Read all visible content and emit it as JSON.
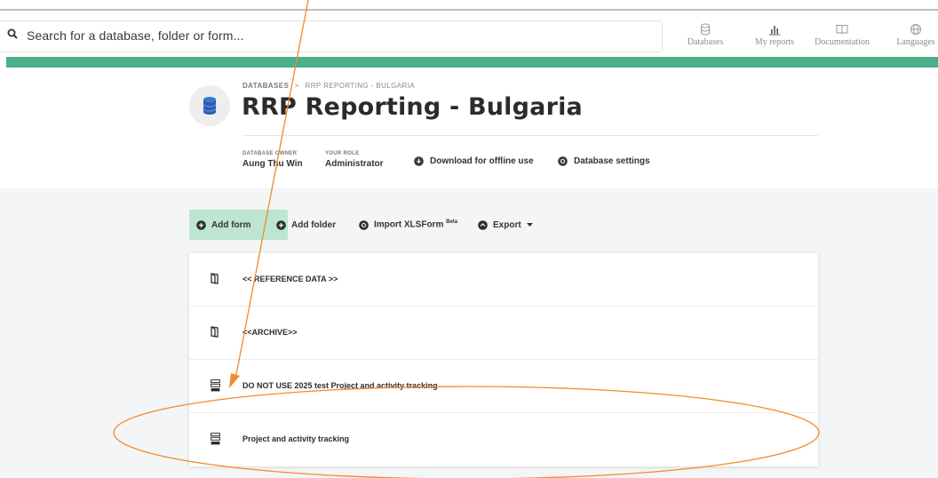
{
  "search": {
    "placeholder": "Search for a database, folder or form..."
  },
  "nav": {
    "databases": "Databases",
    "my_reports": "My reports",
    "documentation": "Documentation",
    "languages": "Languages"
  },
  "breadcrumb": {
    "root": "DATABASES",
    "separator": ">",
    "current": "RRP REPORTING - BULGARIA"
  },
  "title": "RRP Reporting - Bulgaria",
  "meta": {
    "owner_label": "DATABASE OWNER",
    "owner_value": "Aung Thu Win",
    "role_label": "YOUR ROLE",
    "role_value": "Administrator"
  },
  "header_actions": {
    "download": "Download for offline use",
    "settings": "Database settings"
  },
  "toolbar": {
    "add_form": "Add form",
    "add_folder": "Add folder",
    "import": "Import XLSForm",
    "import_badge": "Beta",
    "export": "Export"
  },
  "items": [
    {
      "label": "<< REFERENCE DATA >>",
      "icon": "folder-icon"
    },
    {
      "label": "<<ARCHIVE>>",
      "icon": "folder-icon"
    },
    {
      "label": "DO NOT USE 2025 test Project and activity tracking",
      "icon": "form-icon"
    },
    {
      "label": "Project and activity tracking",
      "icon": "form-icon"
    }
  ],
  "colors": {
    "accent_green": "#4caf87",
    "add_form_bg": "#bde5d2",
    "annotation": "#f08a2c",
    "db_icon": "#2a5db0"
  }
}
